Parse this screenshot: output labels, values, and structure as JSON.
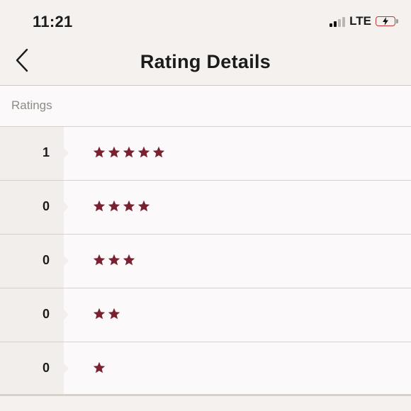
{
  "status": {
    "time": "11:21",
    "network": "LTE"
  },
  "nav": {
    "title": "Rating Details",
    "back_icon": "chevron-left-icon"
  },
  "section": {
    "label": "Ratings"
  },
  "colors": {
    "star": "#7a2131",
    "background": "#f4f1ee"
  },
  "ratings": [
    {
      "stars": 5,
      "count": "1"
    },
    {
      "stars": 4,
      "count": "0"
    },
    {
      "stars": 3,
      "count": "0"
    },
    {
      "stars": 2,
      "count": "0"
    },
    {
      "stars": 1,
      "count": "0"
    }
  ]
}
